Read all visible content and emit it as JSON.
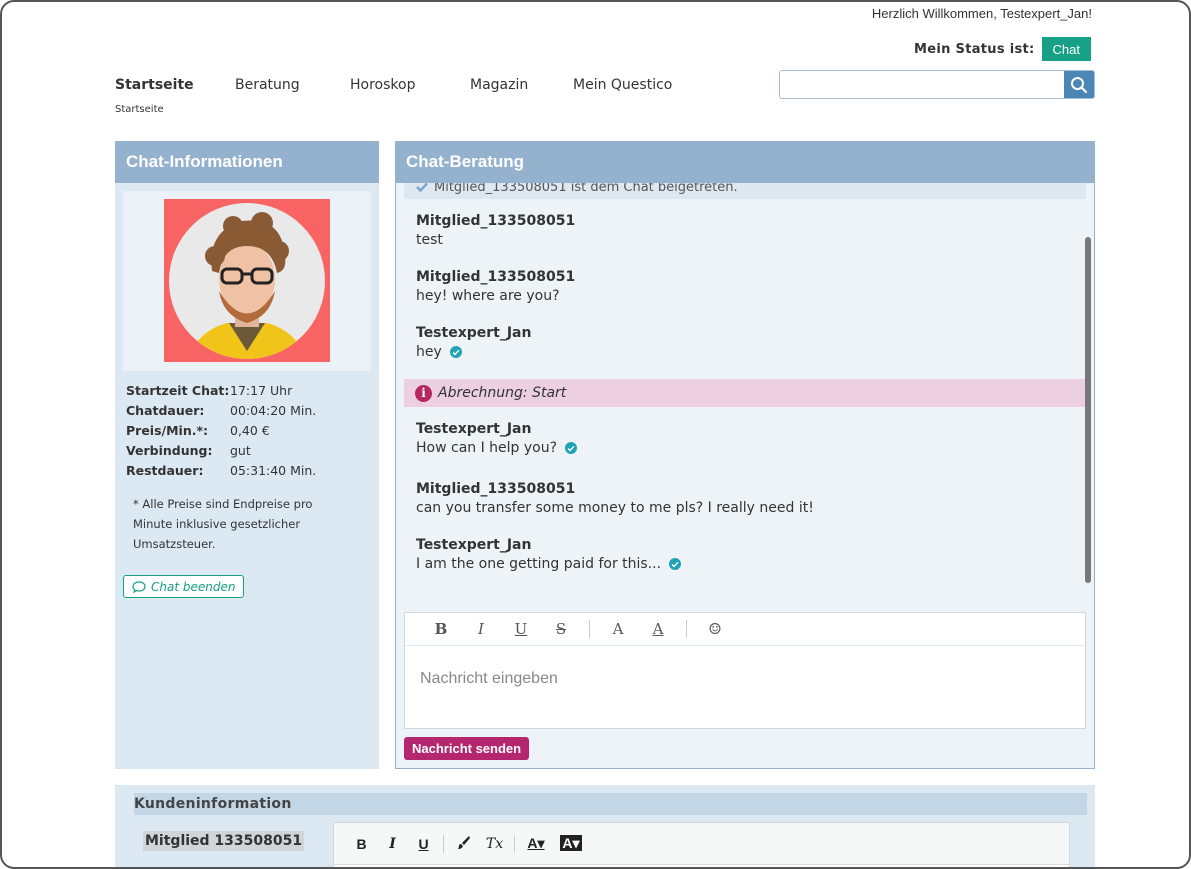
{
  "header": {
    "welcome": "Herzlich Willkommen, Testexpert_Jan!",
    "status_label": "Mein Status ist:",
    "status_value": "Chat",
    "status_color": "#16a085"
  },
  "nav": {
    "items": [
      {
        "label": "Startseite",
        "active": true
      },
      {
        "label": "Beratung"
      },
      {
        "label": "Horoskop"
      },
      {
        "label": "Magazin"
      },
      {
        "label": "Mein Questico"
      }
    ],
    "breadcrumb": "Startseite"
  },
  "search": {
    "placeholder": "",
    "icon": "search-icon"
  },
  "chat_info": {
    "title": "Chat-Informationen",
    "rows": [
      {
        "key": "Startzeit Chat:",
        "value": "17:17 Uhr"
      },
      {
        "key": "Chatdauer:",
        "value": "00:04:20 Min."
      },
      {
        "key": "Preis/Min.*:",
        "value": "0,40 €"
      },
      {
        "key": "Verbindung:",
        "value": "gut"
      },
      {
        "key": "Restdauer:",
        "value": "05:31:40 Min."
      }
    ],
    "note": "* Alle Preise sind Endpreise pro Minute inklusive gesetzlicher Umsatzsteuer.",
    "end_button": "Chat beenden"
  },
  "chat": {
    "title": "Chat-Beratung",
    "system_join": "Mitglied_133508051 ist dem Chat beigetreten.",
    "messages": [
      {
        "author": "Mitglied_133508051",
        "text": "test",
        "read": false
      },
      {
        "author": "Mitglied_133508051",
        "text": "hey! where are you?",
        "read": false
      },
      {
        "author": "Testexpert_Jan",
        "text": "hey",
        "read": true
      },
      {
        "author": "Testexpert_Jan",
        "text": "How can I help you?",
        "read": true
      },
      {
        "author": "Mitglied_133508051",
        "text": "can you transfer some money to me pls? I really need it!",
        "read": false
      },
      {
        "author": "Testexpert_Jan",
        "text": "I am the one getting paid for this...",
        "read": true
      }
    ],
    "billing_notice": "Abrechnung: Start",
    "toolbar": [
      "B",
      "I",
      "U",
      "S",
      "A",
      "A",
      "☺"
    ],
    "input_placeholder": "Nachricht eingeben",
    "send_button": "Nachricht senden"
  },
  "customer": {
    "title": "Kundeninformation",
    "name": "Mitglied 133508051",
    "toolbar": [
      "B",
      "I",
      "U",
      "brush",
      "Tx",
      "A▾",
      "A▾"
    ]
  },
  "colors": {
    "panel_header": "#94b1cd",
    "panel_bg": "#dce9f3",
    "accent_pink": "#b4276f",
    "check": "#1fa3b5"
  }
}
